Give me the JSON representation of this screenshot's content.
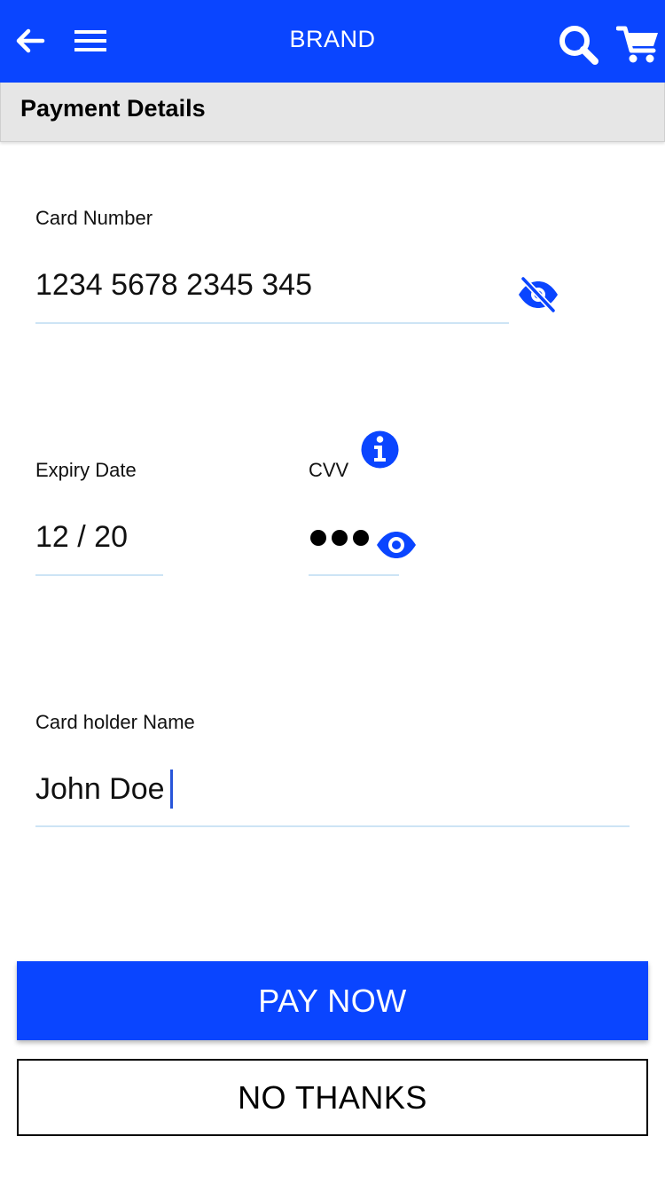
{
  "header": {
    "brand": "BRAND",
    "background_color": "#0a45ff",
    "icons": [
      "back-arrow-icon",
      "hamburger-menu-icon",
      "search-icon",
      "cart-icon"
    ]
  },
  "section": {
    "title": "Payment Details"
  },
  "form": {
    "card_number": {
      "label": "Card Number",
      "value": "1234 5678 2345 345",
      "toggle_icon": "eye-slash-icon"
    },
    "expiry": {
      "label": "Expiry Date",
      "value": "12 / 20"
    },
    "cvv": {
      "label": "CVV",
      "value_masked": "•••",
      "info_icon": "info-icon",
      "toggle_icon": "eye-icon"
    },
    "card_holder": {
      "label": "Card holder Name",
      "value": "John Doe"
    }
  },
  "actions": {
    "pay_label": "PAY NOW",
    "no_thanks_label": "NO THANKS",
    "primary_color": "#0a45ff"
  }
}
